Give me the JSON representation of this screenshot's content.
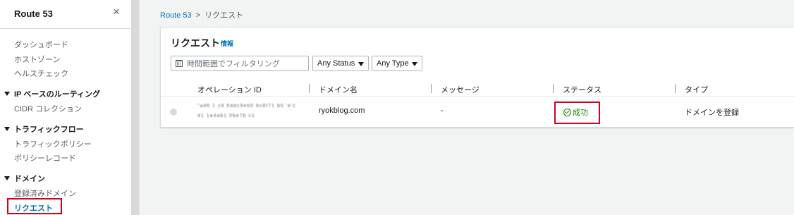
{
  "sidebar": {
    "title": "Route 53",
    "close_icon": "×",
    "items": {
      "dashboard": "ダッシュボード",
      "hosted_zones": "ホストゾーン",
      "health_checks": "ヘルスチェック",
      "cidr_collections": "CIDR コレクション",
      "traffic_policies": "トラフィックポリシー",
      "policy_records": "ポリシーレコード",
      "registered_domains": "登録済みドメイン",
      "requests": "リクエスト"
    },
    "sections": {
      "ip_routing": "IP ベースのルーティング",
      "traffic_flow": "トラフィックフロー",
      "domains": "ドメイン"
    },
    "highlight_color": "#d0021b"
  },
  "breadcrumb": {
    "parent": "Route 53",
    "separator": ">",
    "current": "リクエスト"
  },
  "panel": {
    "title": "リクエスト",
    "info_link": "情報",
    "filter_placeholder": "時間範囲でフィルタリング",
    "status_select": "Any Status",
    "type_select": "Any Type",
    "columns": [
      "オペレーション ID",
      "ドメイン名",
      "メッセージ",
      "ステータス",
      "タイプ"
    ],
    "rows": [
      {
        "operation_id_line1": "\"ad6 1 c8 6ddc9eb5 6c8f71 b0 'e'c",
        "operation_id_line2": "d1 1a4ab1 0be7b c1",
        "domain": "ryokblog.com",
        "message": "-",
        "status": "成功",
        "type": "ドメインを登録"
      }
    ]
  },
  "colors": {
    "link": "#0073bb",
    "success": "#1d8102",
    "annotation_red": "#d0021b"
  },
  "icons": {
    "close": "close-icon",
    "calendar": "calendar-icon",
    "dropdown": "caret-down-icon",
    "success": "check-circle-icon",
    "section": "caret-down-icon"
  }
}
